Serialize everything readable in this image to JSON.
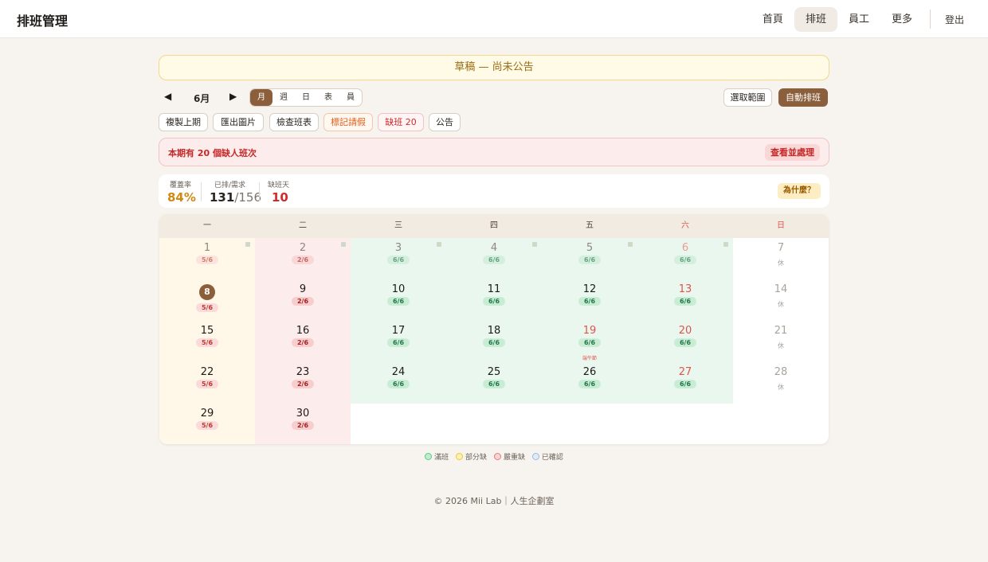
{
  "app": {
    "title": "排班管理"
  },
  "nav": {
    "items": [
      "首頁",
      "排班",
      "員工",
      "更多"
    ],
    "active": "排班",
    "logout": "登出"
  },
  "banner": {
    "text": "草稿 — 尚未公告"
  },
  "toolbar": {
    "prev_icon": "◀",
    "next_icon": "▶",
    "month": "6月",
    "views": [
      "月",
      "週",
      "日",
      "表",
      "員"
    ],
    "active_view": "月",
    "range_label": "選取範圍",
    "auto_label": "自動排班",
    "copy_label": "複製上期",
    "export_label": "匯出圖片",
    "check_label": "檢查班表",
    "leave_label": "標記請假",
    "short_label": "缺班 20",
    "notice_label": "公告"
  },
  "alert": {
    "text": "本期有 20 個缺人班次",
    "action": "查看並處理"
  },
  "stats": {
    "coverage_label": "覆蓋率",
    "coverage_value": "84%",
    "scheduled_label": "已排/需求",
    "scheduled": "131",
    "slash": "/",
    "required": "156",
    "short_days_label": "缺班天",
    "short_days_value": "10",
    "why_label": "為什麼？"
  },
  "calendar": {
    "weekdays": [
      "一",
      "二",
      "三",
      "四",
      "五",
      "六",
      "日"
    ],
    "off_label": "休",
    "days": [
      {
        "day": "1",
        "badge": "5/6",
        "status": "partial"
      },
      {
        "day": "2",
        "badge": "2/6",
        "status": "severe"
      },
      {
        "day": "3",
        "badge": "6/6",
        "status": "full"
      },
      {
        "day": "4",
        "badge": "6/6",
        "status": "full"
      },
      {
        "day": "5",
        "badge": "6/6",
        "status": "full"
      },
      {
        "day": "6",
        "badge": "6/6",
        "status": "full"
      },
      {
        "day": "7",
        "badge": "休",
        "status": "off"
      },
      {
        "day": "8",
        "badge": "5/6",
        "status": "partial",
        "today": true
      },
      {
        "day": "9",
        "badge": "2/6",
        "status": "severe"
      },
      {
        "day": "10",
        "badge": "6/6",
        "status": "full"
      },
      {
        "day": "11",
        "badge": "6/6",
        "status": "full"
      },
      {
        "day": "12",
        "badge": "6/6",
        "status": "full"
      },
      {
        "day": "13",
        "badge": "6/6",
        "status": "full"
      },
      {
        "day": "14",
        "badge": "休",
        "status": "off"
      },
      {
        "day": "15",
        "badge": "5/6",
        "status": "partial"
      },
      {
        "day": "16",
        "badge": "2/6",
        "status": "severe"
      },
      {
        "day": "17",
        "badge": "6/6",
        "status": "full"
      },
      {
        "day": "18",
        "badge": "6/6",
        "status": "full"
      },
      {
        "day": "19",
        "badge": "6/6",
        "status": "full",
        "event": "端午節"
      },
      {
        "day": "20",
        "badge": "6/6",
        "status": "full"
      },
      {
        "day": "21",
        "badge": "休",
        "status": "off"
      },
      {
        "day": "22",
        "badge": "5/6",
        "status": "partial"
      },
      {
        "day": "23",
        "badge": "2/6",
        "status": "severe"
      },
      {
        "day": "24",
        "badge": "6/6",
        "status": "full"
      },
      {
        "day": "25",
        "badge": "6/6",
        "status": "full"
      },
      {
        "day": "26",
        "badge": "6/6",
        "status": "full"
      },
      {
        "day": "27",
        "badge": "6/6",
        "status": "full"
      },
      {
        "day": "28",
        "badge": "休",
        "status": "off"
      },
      {
        "day": "29",
        "badge": "5/6",
        "status": "partial"
      },
      {
        "day": "30",
        "badge": "2/6",
        "status": "severe"
      }
    ]
  },
  "legend": {
    "items": [
      "滿班",
      "部分缺",
      "嚴重缺",
      "已確認"
    ]
  },
  "footer": {
    "text": "© 2026 Mii Lab｜人生企劃室"
  }
}
